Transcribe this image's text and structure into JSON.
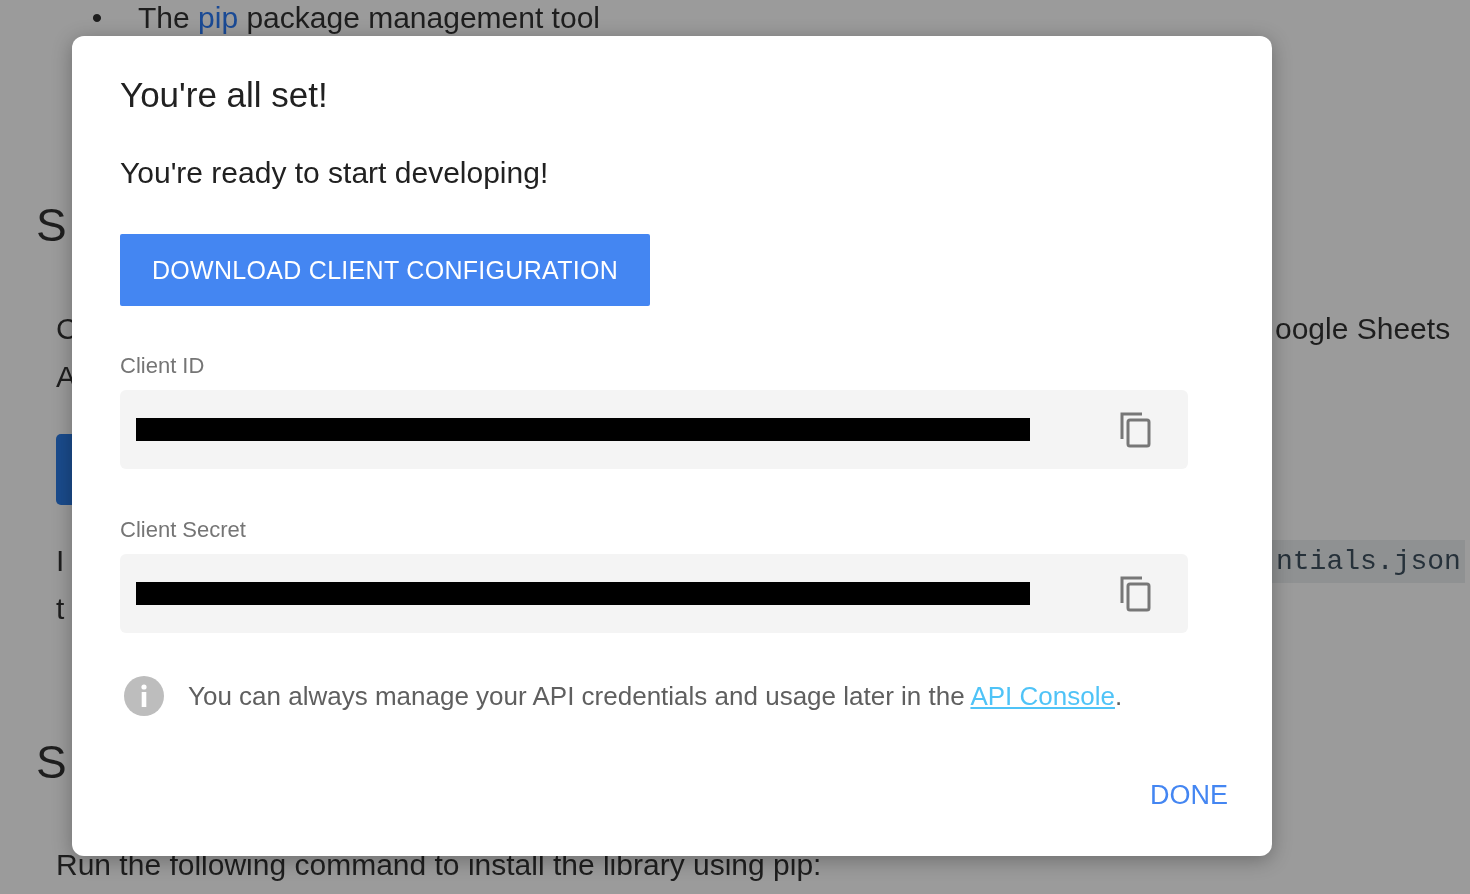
{
  "background": {
    "bullet": {
      "marker": "•",
      "before": "The ",
      "link": "pip",
      "after": " package management tool"
    },
    "heading_1": "S",
    "paragraph_1": {
      "line_1": "C",
      "line_1_end": "oogle Sheets",
      "line_2": "A"
    },
    "paragraph_2": {
      "line_1": "I",
      "code": "ntials.json",
      "line_2": "t"
    },
    "heading_2": "S",
    "paragraph_3": "Run the following command to install the library using pip:"
  },
  "dialog": {
    "title": "You're all set!",
    "message": "You're ready to start developing!",
    "download_button": "DOWNLOAD CLIENT CONFIGURATION",
    "fields": [
      {
        "label": "Client ID"
      },
      {
        "label": "Client Secret"
      }
    ],
    "info": {
      "text": "You can always manage your API credentials and usage later in the ",
      "link": "API Console",
      "after": "."
    },
    "done_button": "DONE"
  }
}
